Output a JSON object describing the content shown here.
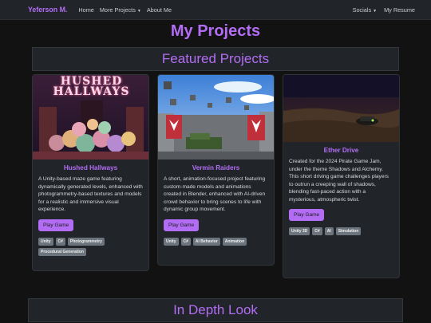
{
  "nav": {
    "brand": "Yeferson M.",
    "home": "Home",
    "more_projects": "More Projects",
    "about": "About Me",
    "socials": "Socials",
    "resume": "My Resume"
  },
  "page_title": "My Projects",
  "featured_title": "Featured Projects",
  "indepth_title": "In Depth Look",
  "cards": [
    {
      "title": "Hushed Hallways",
      "image_text": "HUSHED HALLWAYS",
      "description": "A Unity-based maze game featuring dynamically generated levels, enhanced with photogrammetry-based textures and models for a realistic and immersive visual experience.",
      "button": "Play Game",
      "tags": [
        "Unity",
        "C#",
        "Photogrammetry",
        "Procedural Generation"
      ]
    },
    {
      "title": "Vermin Raiders",
      "description": "A short, animation-focused project featuring custom-made models and animations created in Blender, enhanced with AI-driven crowd behavior to bring scenes to life with dynamic group movement.",
      "button": "Play Game",
      "tags": [
        "Unity",
        "C#",
        "AI Behavior",
        "Animation"
      ]
    },
    {
      "title": "Ether Drive",
      "description": "Created for the 2024 Pirate Game Jam, under the theme Shadows and Alchemy. This short driving game challenges players to outrun a creeping wall of shadows, blending fast-paced action with a mysterious, atmospheric twist.",
      "button": "Play Game",
      "tags": [
        "Unity 3D",
        "C#",
        "AI",
        "Simulation"
      ]
    }
  ],
  "colors": {
    "accent": "#b36df5",
    "navbar": "#212529",
    "background": "#121212"
  }
}
